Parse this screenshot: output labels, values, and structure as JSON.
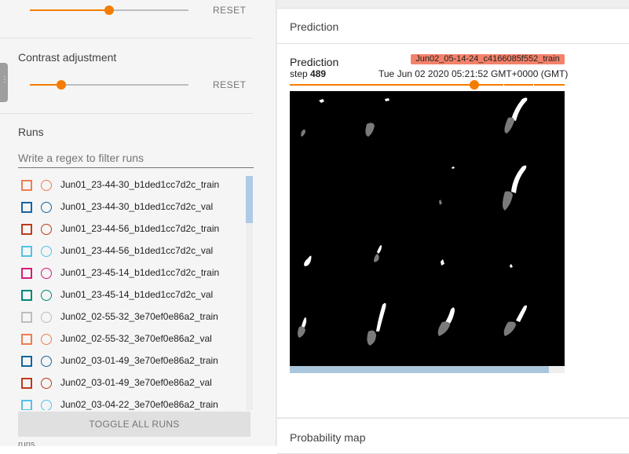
{
  "sidebar": {
    "brightness_reset": "RESET",
    "contrast": {
      "title": "Contrast adjustment",
      "reset": "RESET",
      "level": 0.2
    },
    "brightness_level": 0.5,
    "runs": {
      "title": "Runs",
      "filter_placeholder": "Write a regex to filter runs",
      "items": [
        {
          "label": "Jun01_23-44-30_b1ded1cc7d2c_train",
          "color": "#ef7d4e"
        },
        {
          "label": "Jun01_23-44-30_b1ded1cc7d2c_val",
          "color": "#1565a0"
        },
        {
          "label": "Jun01_23-44-56_b1ded1cc7d2c_train",
          "color": "#c0391e"
        },
        {
          "label": "Jun01_23-44-56_b1ded1cc7d2c_val",
          "color": "#4fc3e8"
        },
        {
          "label": "Jun01_23-45-14_b1ded1cc7d2c_train",
          "color": "#d81b7a"
        },
        {
          "label": "Jun01_23-45-14_b1ded1cc7d2c_val",
          "color": "#00897b"
        },
        {
          "label": "Jun02_02-55-32_3e70ef0e86a2_train",
          "color": "#bdbdbd"
        },
        {
          "label": "Jun02_02-55-32_3e70ef0e86a2_val",
          "color": "#ef7d4e"
        },
        {
          "label": "Jun02_03-01-49_3e70ef0e86a2_train",
          "color": "#1565a0"
        },
        {
          "label": "Jun02_03-01-49_3e70ef0e86a2_val",
          "color": "#c0391e"
        },
        {
          "label": "Jun02_03-04-22_3e70ef0e86a2_train",
          "color": "#4fc3e8"
        }
      ],
      "toggle_all": "TOGGLE ALL RUNS",
      "cut_label": "runs"
    }
  },
  "main": {
    "section_title": "Prediction",
    "image_card": {
      "title": "Prediction",
      "step_label": "step",
      "step_value": "489",
      "run_name": "Jun02_05-14-24_c4166085f552_train",
      "run_color": "#f4826a",
      "timestamp": "Tue Jun 02 2020 05:21:52 GMT+0000 (GMT)",
      "step_position": 0.67
    },
    "next_section_title": "Probability map"
  },
  "colors": {
    "accent": "#f57c00"
  }
}
